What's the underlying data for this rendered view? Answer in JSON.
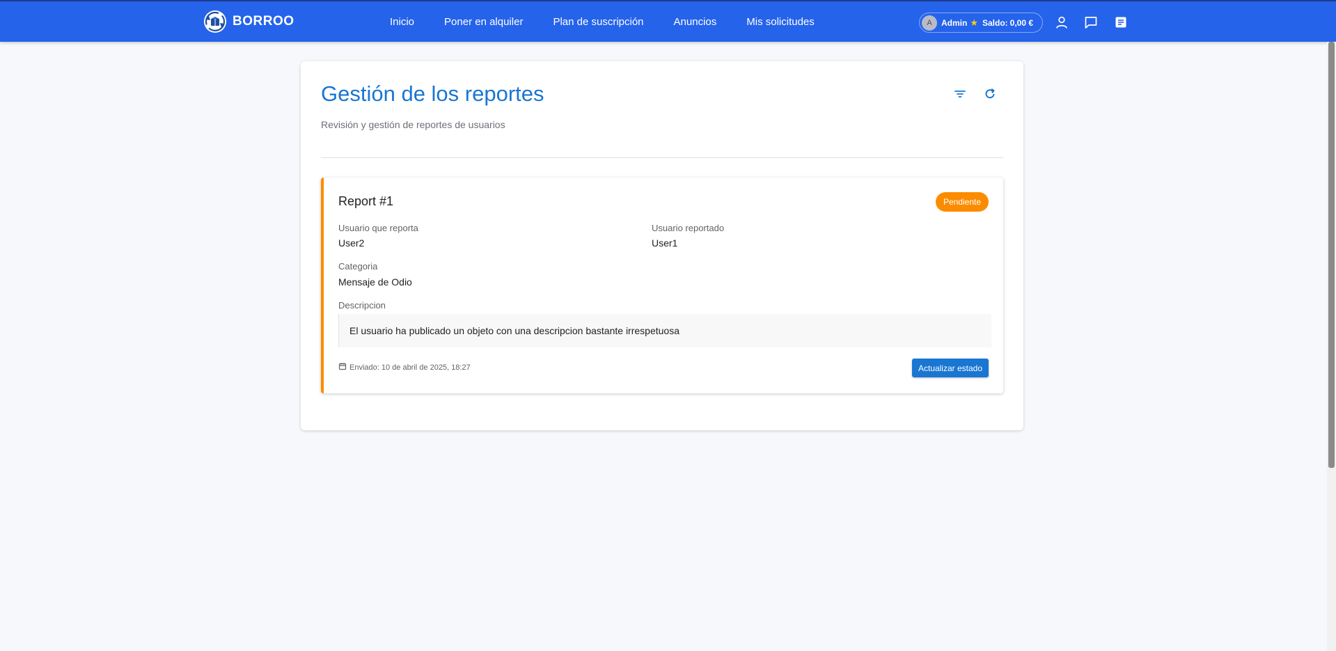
{
  "brand": {
    "name": "BORROO",
    "logo_icon": "recycle-box-logo",
    "color": "#2563eb"
  },
  "nav": {
    "items": [
      {
        "label": "Inicio"
      },
      {
        "label": "Poner en alquiler"
      },
      {
        "label": "Plan de suscripción"
      },
      {
        "label": "Anuncios"
      },
      {
        "label": "Mis solicitudes"
      }
    ]
  },
  "account": {
    "avatar_initial": "A",
    "username": "Admin",
    "badge_icon": "star-icon",
    "balance_label": "Saldo:",
    "balance_value": "0,00 €",
    "icons": [
      "user-icon",
      "chat-icon",
      "notes-icon"
    ]
  },
  "page": {
    "title": "Gestión de los reportes",
    "subtitle": "Revisión y gestión de reportes de usuarios",
    "actions": [
      "filter-icon",
      "refresh-icon"
    ],
    "accent_color": "#1976d2"
  },
  "report": {
    "title": "Report #1",
    "status": "Pendiente",
    "status_color": "#fb8c00",
    "reporter_label": "Usuario que reporta",
    "reporter_value": "User2",
    "reported_label": "Usuario reportado",
    "reported_value": "User1",
    "category_label": "Categoria",
    "category_value": "Mensaje de Odio",
    "description_label": "Descripcion",
    "description_value": "El usuario ha publicado un objeto con una descripcion bastante irrespetuosa",
    "sent_text": "Enviado: 10 de abril de 2025, 18:27",
    "update_button_label": "Actualizar estado"
  }
}
